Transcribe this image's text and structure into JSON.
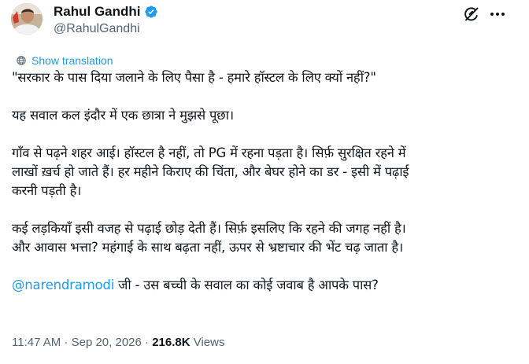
{
  "author": {
    "display_name": "Rahul Gandhi",
    "handle": "@RahulGandhi",
    "verified_badge_color": "#1d9bf0"
  },
  "header_icons": {
    "grok": "grok-icon",
    "more": "more-options-icon"
  },
  "translation": {
    "label": "Show translation"
  },
  "tweet": {
    "lines": [
      "\"सरकार के पास दिया जलाने के लिए पैसा है - हमारे हॉस्टल के लिए क्यों नहीं?\"",
      "",
      "यह सवाल कल इंदौर में एक छात्रा ने मुझसे पूछा।",
      "",
      "गाँव से पढ़ने शहर आई। हॉस्टल है नहीं, तो PG में रहना पड़ता है। सिर्फ़ सुरक्षित रहने में",
      "लाखों ख़र्च हो जाते हैं। हर महीने किराए की चिंता, और बेघर होने का डर - इसी में पढ़ाई",
      "करनी पड़ती है।",
      "",
      "कई लड़कियाँ इसी वजह से पढ़ाई छोड़ देती हैं। सिर्फ़ इसलिए कि रहने की जगह नहीं है।",
      "और आवास भत्ता? महंगाई के साथ बढ़ता नहीं, ऊपर से भ्रष्टाचार की भेंट चढ़ जाता है।",
      ""
    ],
    "mention": "@narendramodi",
    "last_line_rest": " जी - उस बच्ची के सवाल का कोई जवाब है आपके पास?"
  },
  "meta": {
    "time": "11:47 AM",
    "separator": " · ",
    "date": "Sep 20, 2026",
    "views_count": "216.8K",
    "views_label": " Views"
  },
  "colors": {
    "accent": "#1d9bf0",
    "text": "#0f1419",
    "secondary": "#536471"
  }
}
